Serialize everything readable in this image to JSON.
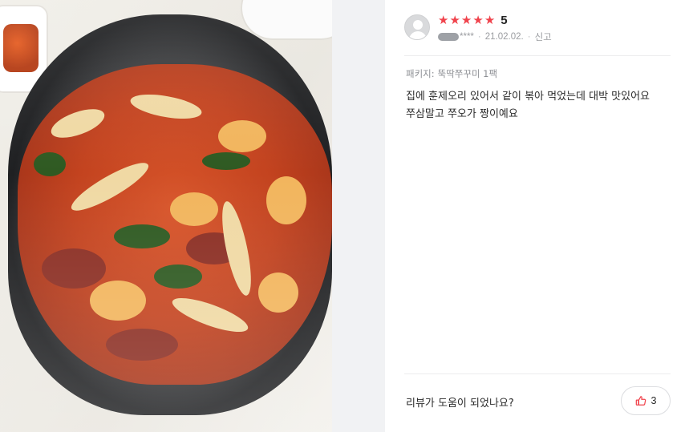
{
  "review": {
    "rating_stars": 5,
    "score_label": "5",
    "nickname_masked": "****",
    "date": "21.02.02.",
    "report_label": "신고",
    "package_label": "패키지:",
    "package_value": "뚝딱쭈꾸미 1팩",
    "text_line1": "집에 훈제오리 있어서 같이 볶아 먹었는데 대박 맛있어요",
    "text_line2": "쭈삼말고 쭈오가 짱이예요"
  },
  "feedback": {
    "question": "리뷰가 도움이 되었나요?",
    "like_count": "3"
  },
  "colors": {
    "star": "#f0434c",
    "like_icon": "#f0434c",
    "divider_bg": "#f1f2f4"
  },
  "icons": {
    "avatar": "default-user-icon",
    "star": "star-icon",
    "like": "thumbs-up-icon"
  }
}
